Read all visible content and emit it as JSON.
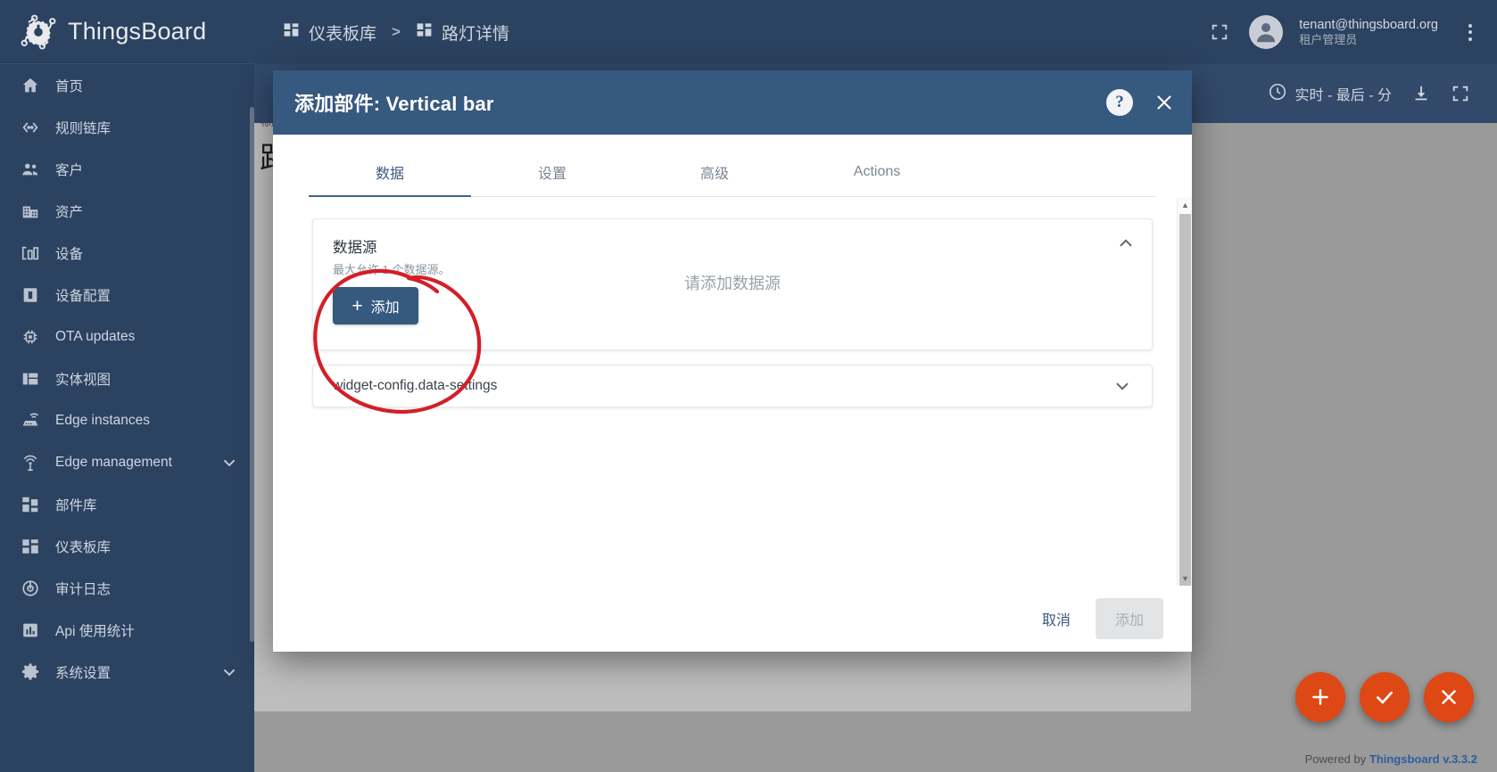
{
  "app": {
    "brand": "ThingsBoard",
    "footer_prefix": "Powered by",
    "footer_brand": "Thingsboard v.3.3.2"
  },
  "sidebar": {
    "items": [
      {
        "label": "首页",
        "icon": "home-icon"
      },
      {
        "label": "规则链库",
        "icon": "rule-chain-icon"
      },
      {
        "label": "客户",
        "icon": "customers-icon"
      },
      {
        "label": "资产",
        "icon": "assets-icon"
      },
      {
        "label": "设备",
        "icon": "devices-icon"
      },
      {
        "label": "设备配置",
        "icon": "device-profile-icon"
      },
      {
        "label": "OTA updates",
        "icon": "ota-icon"
      },
      {
        "label": "实体视图",
        "icon": "entity-view-icon"
      },
      {
        "label": "Edge instances",
        "icon": "edge-instance-icon"
      },
      {
        "label": "Edge management",
        "icon": "edge-management-icon",
        "expandable": true
      },
      {
        "label": "部件库",
        "icon": "widget-library-icon"
      },
      {
        "label": "仪表板库",
        "icon": "dashboard-library-icon"
      },
      {
        "label": "审计日志",
        "icon": "audit-log-icon"
      },
      {
        "label": "Api 使用统计",
        "icon": "api-usage-icon"
      },
      {
        "label": "系统设置",
        "icon": "settings-gear-icon",
        "expandable": true
      }
    ]
  },
  "topbar": {
    "breadcrumb": [
      {
        "label": "仪表板库",
        "icon": "dashboard-library-icon"
      },
      {
        "label": "路灯详情",
        "icon": "dashboard-icon"
      }
    ],
    "separator": ">",
    "fullscreen_icon": "fullscreen-icon",
    "user_email": "tenant@thingsboard.org",
    "user_role": "租户管理员",
    "more_icon": "kebab-menu-icon"
  },
  "dashboard_toolbar": {
    "time_label": "实时 - 最后 - 分",
    "clock_icon": "clock-icon",
    "download_icon": "download-icon",
    "fullscreen_icon": "fullscreen-icon"
  },
  "dashboard_background": {
    "subtitle": "标题",
    "title": "路灯详情"
  },
  "modal": {
    "title": "添加部件: Vertical bar",
    "help_icon": "help-question-icon",
    "close_icon": "close-x-icon",
    "tabs": [
      {
        "label": "数据",
        "active": true
      },
      {
        "label": "设置",
        "active": false
      },
      {
        "label": "高级",
        "active": false
      },
      {
        "label": "Actions",
        "active": false
      }
    ],
    "datasource_panel": {
      "title": "数据源",
      "subtitle": "最大允许 1 个数据源。",
      "empty_text": "请添加数据源",
      "add_button": "添加",
      "add_icon": "plus-icon",
      "collapse_icon": "chevron-up-icon"
    },
    "settings_panel": {
      "label": "widget-config.data-settings",
      "expand_icon": "chevron-down-icon"
    },
    "footer": {
      "cancel": "取消",
      "confirm": "添加"
    },
    "scrollbar": {
      "up_icon": "scroll-up-arrow-icon",
      "down_icon": "scroll-down-arrow-icon"
    }
  },
  "fabs": [
    {
      "icon": "plus-icon",
      "name": "add-widget-fab"
    },
    {
      "icon": "check-icon",
      "name": "apply-changes-fab"
    },
    {
      "icon": "close-x-icon",
      "name": "discard-changes-fab"
    }
  ],
  "annotation": {
    "type": "hand-drawn-circle",
    "color": "#d31f28",
    "targets": "add-datasource-button"
  },
  "colors": {
    "sidebar_bg": "#2b4260",
    "topbar_bg": "#2b4260",
    "modal_header_bg": "#36597f",
    "accent_button": "#36597f",
    "fab_orange": "#dd4814",
    "annotation_red": "#d31f28",
    "dashboard_bg": "#9a9a9a"
  }
}
